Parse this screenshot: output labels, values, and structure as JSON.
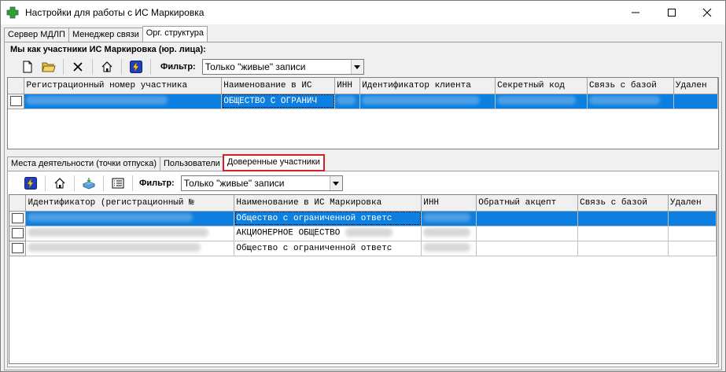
{
  "window": {
    "title": "Настройки для работы с ИС Маркировка"
  },
  "main_tabs": [
    {
      "label": "Сервер МДЛП",
      "active": false
    },
    {
      "label": "Менеджер связи",
      "active": false
    },
    {
      "label": "Орг. структура",
      "active": true
    }
  ],
  "top_section": {
    "title": "Мы как участники ИС Маркировка (юр. лица):",
    "filter_label": "Фильтр:",
    "filter_value": "Только \"живые\" записи",
    "toolbar_icons": [
      "new-document-icon",
      "open-folder-icon",
      "delete-icon",
      "home-icon",
      "lightning-icon"
    ],
    "columns": [
      "Регистрационный номер участника",
      "Наименование в ИС",
      "ИНН",
      "Идентификатор клиента",
      "Секретный код",
      "Связь с базой",
      "Удален"
    ],
    "rows": [
      {
        "cells": [
          "",
          "ОБЩЕСТВО С ОГРАНИЧ",
          "",
          "",
          "",
          "",
          ""
        ],
        "selected": true
      }
    ]
  },
  "bottom_tabs": [
    {
      "label": "Места деятельности (точки отпуска)",
      "active": false
    },
    {
      "label": "Пользователи",
      "active": false
    },
    {
      "label": "Доверенные участники",
      "active": true
    }
  ],
  "bottom_section": {
    "filter_label": "Фильтр:",
    "filter_value": "Только \"живые\" записи",
    "toolbar_icons": [
      "lightning-icon",
      "home-icon",
      "import-icon",
      "list-icon"
    ],
    "columns": [
      "Идентификатор (регистрационный №",
      "Наименование в ИС Маркировка",
      "ИНН",
      "Обратный акцепт",
      "Связь с базой",
      "Удален"
    ],
    "rows": [
      {
        "cells": [
          "",
          "Общество с ограниченной ответс",
          "",
          "",
          "",
          ""
        ],
        "selected": true
      },
      {
        "cells": [
          "",
          "АКЦИОНЕРНОЕ ОБЩЕСТВО",
          "",
          "",
          "",
          ""
        ],
        "selected": false
      },
      {
        "cells": [
          "",
          "Общество с ограниченной ответс",
          "",
          "",
          "",
          ""
        ],
        "selected": false
      }
    ]
  },
  "colors": {
    "selection": "#0c7fe0",
    "highlight_border": "#d91f26",
    "app_icon": "#2e9e3e"
  }
}
